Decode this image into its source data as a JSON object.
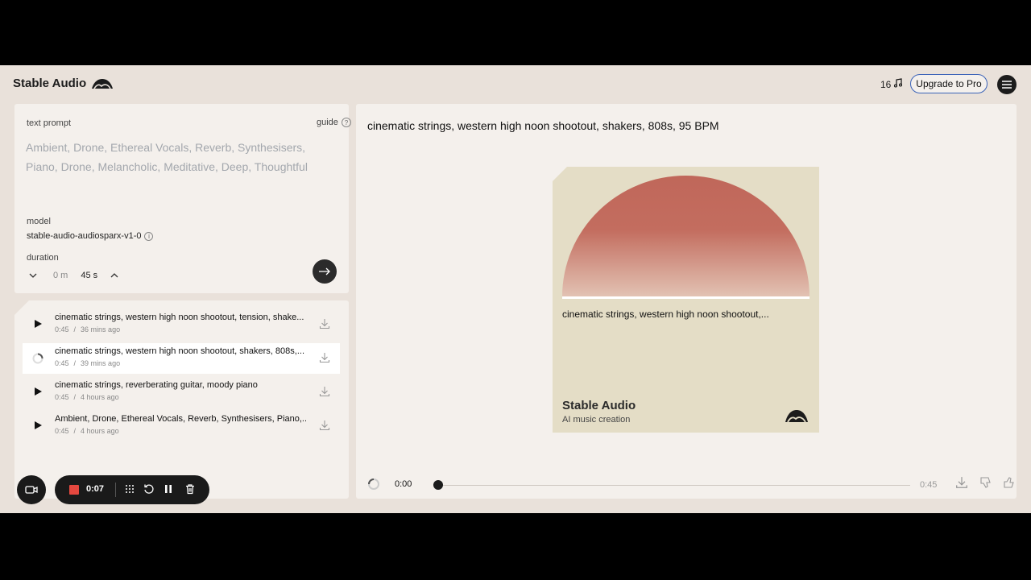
{
  "header": {
    "brand": "Stable Audio",
    "credits": "16",
    "upgrade_label": "Upgrade to Pro",
    "icons": [
      "stable-audio-logo-icon",
      "music-note-icon",
      "hamburger-menu-icon"
    ]
  },
  "prompt": {
    "label": "text prompt",
    "guide_label": "guide",
    "placeholder": "Ambient, Drone, Ethereal Vocals, Reverb, Synthesisers, Piano, Drone, Melancholic, Meditative, Deep, Thoughtful",
    "model_label": "model",
    "model_value": "stable-audio-audiosparx-v1-0",
    "duration_label": "duration",
    "duration_minutes": "0 m",
    "duration_seconds": "45 s"
  },
  "history": [
    {
      "title": "cinematic strings, western high noon shootout, tension, shake...",
      "length": "0:45",
      "age": "36 mins ago",
      "state": "idle"
    },
    {
      "title": "cinematic strings, western high noon shootout, shakers, 808s,...",
      "length": "0:45",
      "age": "39 mins ago",
      "state": "loading"
    },
    {
      "title": "cinematic strings, reverberating guitar, moody piano",
      "length": "0:45",
      "age": "4 hours ago",
      "state": "idle"
    },
    {
      "title": "Ambient, Drone, Ethereal Vocals, Reverb, Synthesisers, Piano,...",
      "length": "0:45",
      "age": "4 hours ago",
      "state": "idle"
    }
  ],
  "history_sep": "/",
  "main": {
    "title": "cinematic strings, western high noon shootout, shakers, 808s, 95 BPM",
    "card_title": "cinematic strings, western high noon shootout,...",
    "card_brand": "Stable Audio",
    "card_subtitle": "AI music creation",
    "card_colors": {
      "background": "#e4ddc6",
      "sun_top": "#c0675a",
      "sun_bottom": "#e2c2b3"
    }
  },
  "player": {
    "current_time": "0:00",
    "total_time": "0:45",
    "progress": 0
  },
  "recorder": {
    "time": "0:07",
    "stop_color": "#e5483f"
  }
}
